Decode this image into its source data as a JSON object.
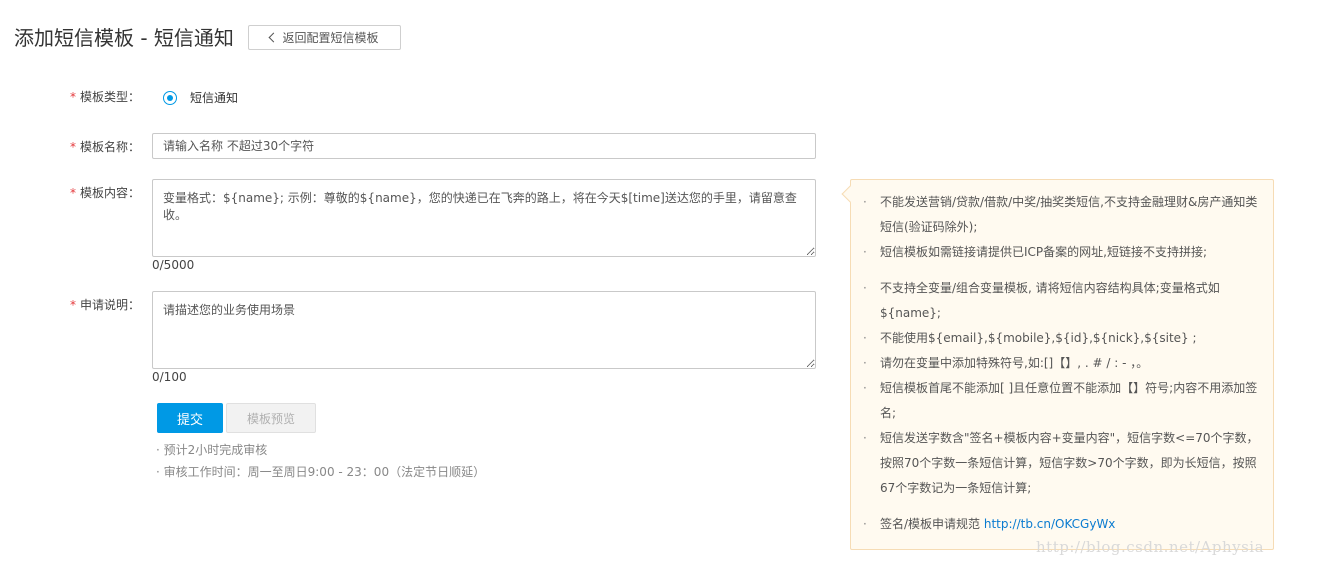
{
  "header": {
    "title": "添加短信模板 - 短信通知",
    "back_button": "返回配置短信模板"
  },
  "form": {
    "type": {
      "label": "模板类型：",
      "option": "短信通知",
      "selected": true
    },
    "name": {
      "label": "模板名称：",
      "placeholder": "请输入名称 不超过30个字符"
    },
    "content": {
      "label": "模板内容：",
      "placeholder": "变量格式：${name}; 示例：尊敬的${name}，您的快递已在飞奔的路上，将在今天$[time]送达您的手里，请留意查收。",
      "counter": "0/5000"
    },
    "description": {
      "label": "申请说明：",
      "placeholder": "请描述您的业务使用场景",
      "counter": "0/100"
    },
    "required_mark": "*"
  },
  "actions": {
    "submit": "提交",
    "preview": "模板预览"
  },
  "hints": [
    "· 预计2小时完成审核",
    "· 审核工作时间：周一至周日9:00 - 23：00（法定节日顺延）"
  ],
  "tips": [
    "不能发送营销/贷款/借款/中奖/抽奖类短信,不支持金融理财&房产通知类短信(验证码除外);",
    "短信模板如需链接请提供已ICP备案的网址,短链接不支持拼接;",
    "不支持全变量/组合变量模板, 请将短信内容结构具体;变量格式如${name};",
    "不能使用${email},${mobile},${id},${nick},${site} ;",
    "请勿在变量中添加特殊符号,如:[]【】, . # / : - ，。",
    "短信模板首尾不能添加[ ]且任意位置不能添加【】符号;内容不用添加签名;",
    "短信发送字数含\"签名+模板内容+变量内容\"，短信字数<=70个字数，按照70个字数一条短信计算，短信字数>70个字数，即为长短信，按照67个字数记为一条短信计算;"
  ],
  "tip_link": {
    "prefix": "签名/模板申请规范 ",
    "url": "http://tb.cn/OKCGyWx"
  },
  "watermark": "http://blog.csdn.net/Aphysia",
  "colors": {
    "primary": "#0099e5",
    "required": "#e4393c",
    "tip_bg": "#fffaf0",
    "tip_border": "#f6dcb5",
    "link": "#0a7bd0"
  }
}
